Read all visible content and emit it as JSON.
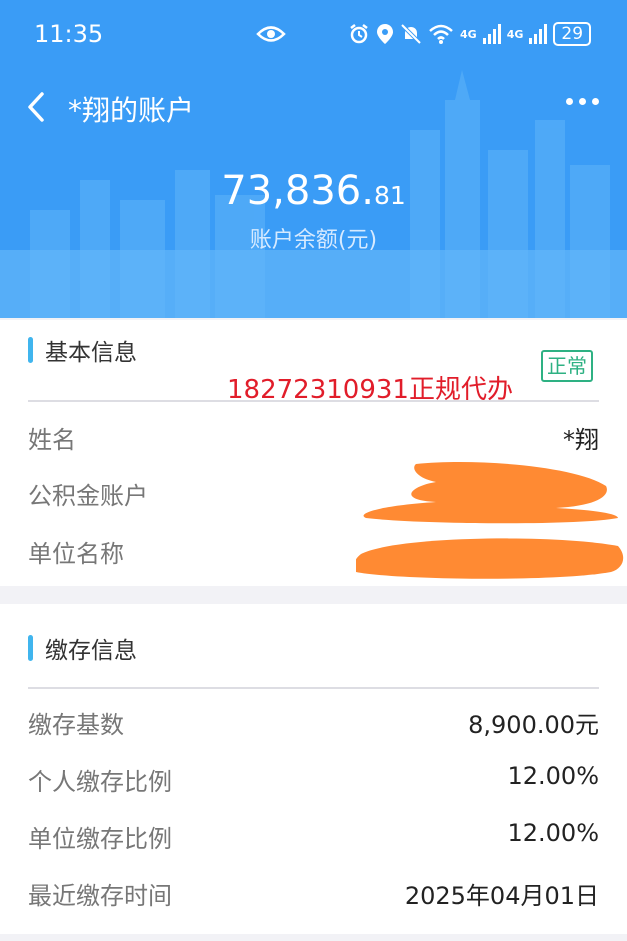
{
  "status_bar": {
    "time": "11:35",
    "network_1": "4G",
    "network_2": "4G",
    "battery": "29",
    "icons": [
      "eye-icon",
      "alarm-icon",
      "location-icon",
      "mute-icon",
      "wifi-icon",
      "signal-icon",
      "signal-icon",
      "battery-icon"
    ]
  },
  "header": {
    "title": "*翔的账户",
    "balance_integer": "73,836.",
    "balance_decimal": "81",
    "balance_label": "账户余额(元)",
    "background_color": "#3a9cf6"
  },
  "basic_info": {
    "title": "基本信息",
    "status_badge": "正常",
    "watermark": "18272310931正规代办",
    "rows": [
      {
        "label": "姓名",
        "value": "*翔"
      },
      {
        "label": "公积金账户",
        "value": ""
      },
      {
        "label": "单位名称",
        "value": ""
      }
    ]
  },
  "deposit_info": {
    "title": "缴存信息",
    "rows": [
      {
        "label": "缴存基数",
        "value": "8,900.00元"
      },
      {
        "label": "个人缴存比例",
        "value": "12.00%"
      },
      {
        "label": "单位缴存比例",
        "value": "12.00%"
      },
      {
        "label": "最近缴存时间",
        "value": "2025年04月01日"
      }
    ]
  },
  "colors": {
    "accent": "#40b5ee",
    "badge": "#2eb183",
    "watermark": "#e11d2a",
    "redaction": "#ff8a33"
  }
}
